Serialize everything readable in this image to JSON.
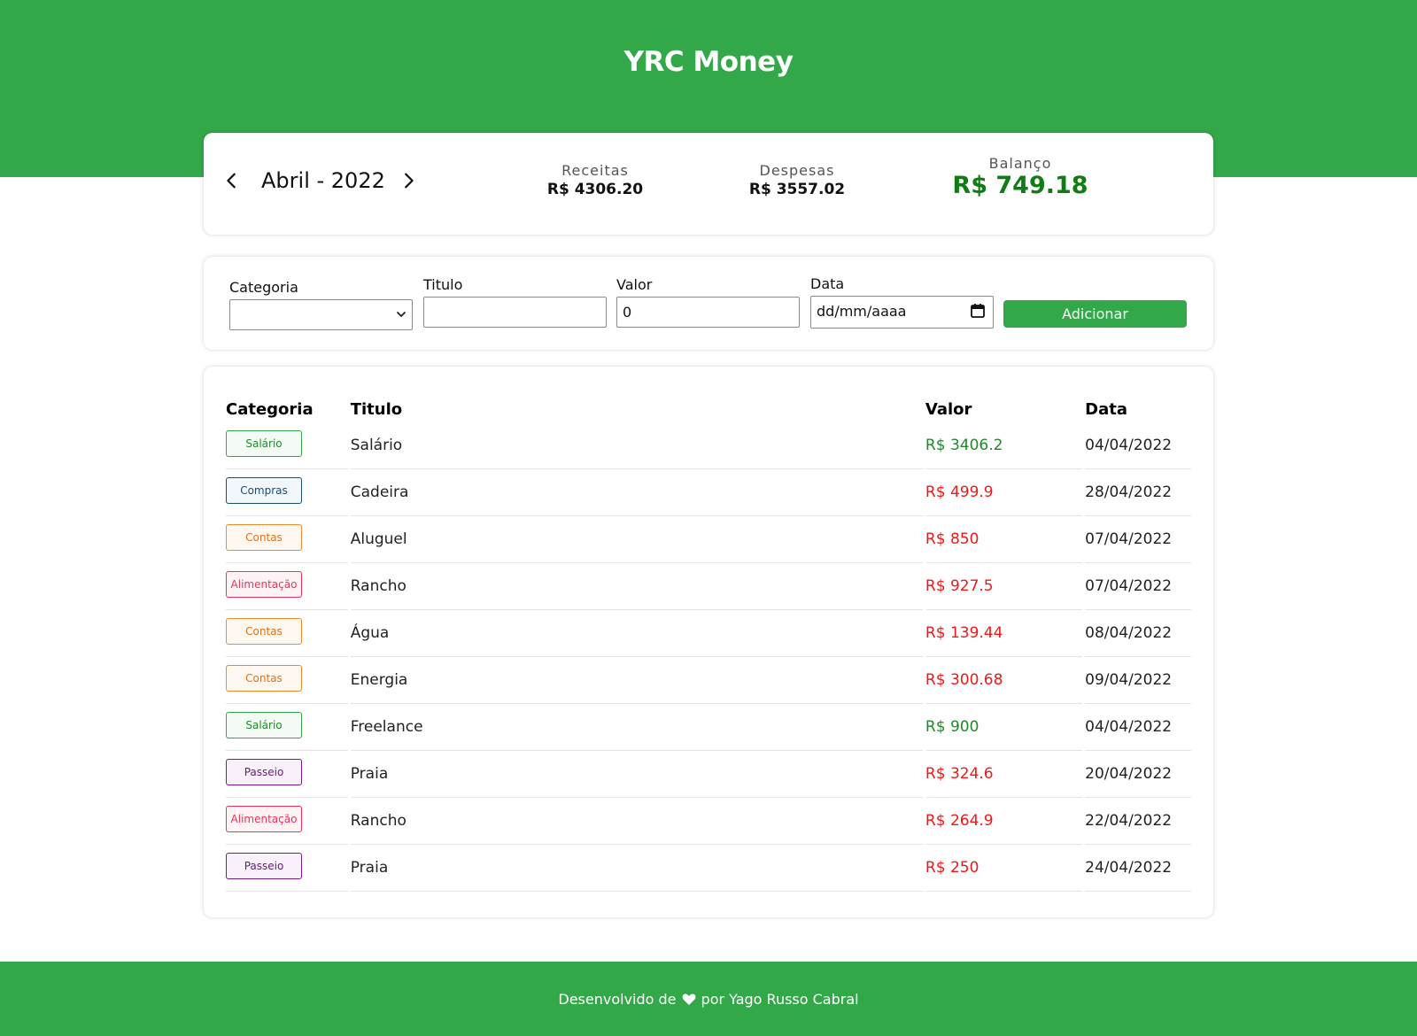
{
  "app": {
    "title": "YRC Money"
  },
  "summary": {
    "month_label": "Abril - 2022",
    "receitas_label": "Receitas",
    "receitas_value": "R$ 4306.20",
    "despesas_label": "Despesas",
    "despesas_value": "R$ 3557.02",
    "balanco_label": "Balanço",
    "balanco_value": "R$ 749.18",
    "balanco_color": "#0f7d14"
  },
  "form": {
    "categoria_label": "Categoria",
    "categoria_value": "",
    "titulo_label": "Titulo",
    "titulo_value": "",
    "valor_label": "Valor",
    "valor_value": "0",
    "data_label": "Data",
    "data_placeholder": "dd/mm/aaaa",
    "add_label": "Adicionar"
  },
  "table": {
    "headers": {
      "categoria": "Categoria",
      "titulo": "Titulo",
      "valor": "Valor",
      "data": "Data"
    },
    "rows": [
      {
        "categoria": "Salário",
        "titulo": "Salário",
        "valor": "R$ 3406.2",
        "data": "04/04/2022",
        "expense": false
      },
      {
        "categoria": "Compras",
        "titulo": "Cadeira",
        "valor": "R$ 499.9",
        "data": "28/04/2022",
        "expense": true
      },
      {
        "categoria": "Contas",
        "titulo": "Aluguel",
        "valor": "R$ 850",
        "data": "07/04/2022",
        "expense": true
      },
      {
        "categoria": "Alimentação",
        "titulo": "Rancho",
        "valor": "R$ 927.5",
        "data": "07/04/2022",
        "expense": true
      },
      {
        "categoria": "Contas",
        "titulo": "Água",
        "valor": "R$ 139.44",
        "data": "08/04/2022",
        "expense": true
      },
      {
        "categoria": "Contas",
        "titulo": "Energia",
        "valor": "R$ 300.68",
        "data": "09/04/2022",
        "expense": true
      },
      {
        "categoria": "Salário",
        "titulo": "Freelance",
        "valor": "R$ 900",
        "data": "04/04/2022",
        "expense": false
      },
      {
        "categoria": "Passeio",
        "titulo": "Praia",
        "valor": "R$ 324.6",
        "data": "20/04/2022",
        "expense": true
      },
      {
        "categoria": "Alimentação",
        "titulo": "Rancho",
        "valor": "R$ 264.9",
        "data": "22/04/2022",
        "expense": true
      },
      {
        "categoria": "Passeio",
        "titulo": "Praia",
        "valor": "R$ 250",
        "data": "24/04/2022",
        "expense": true
      }
    ]
  },
  "category_colors": {
    "Salário": {
      "border": "#32a849",
      "text": "#1e8a2a",
      "bg": "#f4fbf5"
    },
    "Compras": {
      "border": "#1a4d6e",
      "text": "#1a4d6e",
      "bg": "#f2f7fb"
    },
    "Contas": {
      "border": "#f08a2c",
      "text": "#e0701a",
      "bg": "#fff8f0"
    },
    "Alimentação": {
      "border": "#e8355a",
      "text": "#e8355a",
      "bg": "#fff3f6"
    },
    "Passeio": {
      "border": "#7a1a8a",
      "text": "#6a1a78",
      "bg": "#f8f0fa"
    }
  },
  "colors": {
    "brand": "#32a849",
    "income": "#1e8a2a",
    "expense": "#f01818"
  },
  "footer": {
    "prefix": "Desenvolvido de",
    "suffix": "por Yago Russo Cabral",
    "icon": "heart-icon"
  }
}
